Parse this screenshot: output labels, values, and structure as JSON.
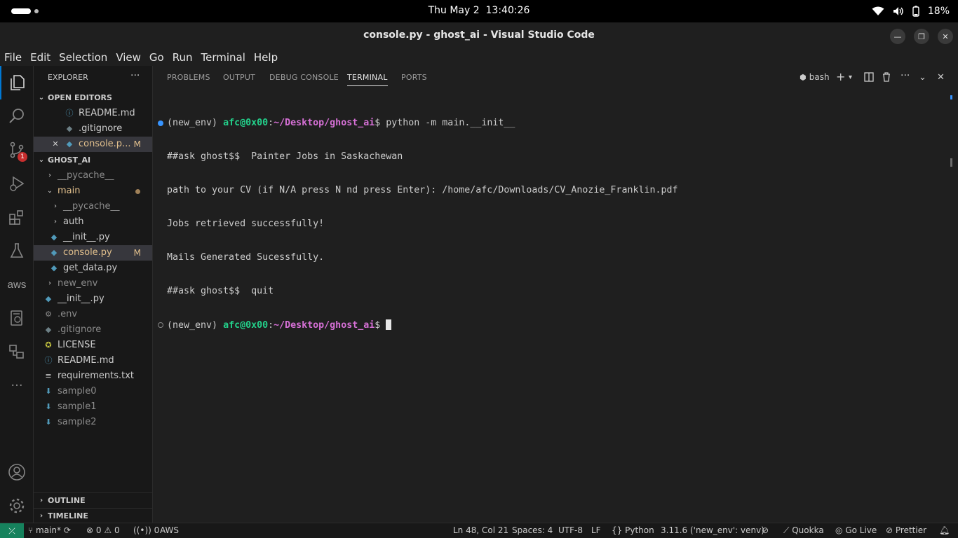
{
  "topbar": {
    "clock": "Thu May 2  13:40:26",
    "battery": "18%"
  },
  "window": {
    "title": "console.py - ghost_ai - Visual Studio Code"
  },
  "menu": [
    "File",
    "Edit",
    "Selection",
    "View",
    "Go",
    "Run",
    "Terminal",
    "Help"
  ],
  "activity": {
    "scm_badge": "1",
    "aws_label": "aws"
  },
  "sidebar": {
    "title": "EXPLORER",
    "open_editors_label": "OPEN EDITORS",
    "open_editors": [
      {
        "name": "README.md",
        "mod": ""
      },
      {
        "name": ".gitignore",
        "mod": ""
      },
      {
        "name": "console.p...",
        "mod": "M"
      }
    ],
    "project_label": "GHOST_AI",
    "tree": [
      {
        "name": "__pycache__",
        "mod": ""
      },
      {
        "name": "main",
        "mod": ""
      },
      {
        "name": "__pycache__",
        "mod": ""
      },
      {
        "name": "auth",
        "mod": ""
      },
      {
        "name": "__init__.py",
        "mod": ""
      },
      {
        "name": "console.py",
        "mod": "M"
      },
      {
        "name": "get_data.py",
        "mod": ""
      },
      {
        "name": "new_env",
        "mod": ""
      },
      {
        "name": "__init__.py",
        "mod": ""
      },
      {
        "name": ".env",
        "mod": ""
      },
      {
        "name": ".gitignore",
        "mod": ""
      },
      {
        "name": "LICENSE",
        "mod": ""
      },
      {
        "name": "README.md",
        "mod": ""
      },
      {
        "name": "requirements.txt",
        "mod": ""
      },
      {
        "name": "sample0",
        "mod": ""
      },
      {
        "name": "sample1",
        "mod": ""
      },
      {
        "name": "sample2",
        "mod": ""
      }
    ],
    "outline_label": "OUTLINE",
    "timeline_label": "TIMELINE"
  },
  "panel": {
    "tabs": [
      "PROBLEMS",
      "OUTPUT",
      "DEBUG CONSOLE",
      "TERMINAL",
      "PORTS"
    ],
    "active_tab": "TERMINAL",
    "shell": "bash"
  },
  "terminal": {
    "env": "(new_env) ",
    "user": "afc@0x00",
    "colon": ":",
    "path": "~/Desktop/ghost_ai",
    "dollar": "$ ",
    "command": "python -m main.__init__",
    "lines": [
      "##ask ghost$$  Painter Jobs in Saskachewan",
      "path to your CV (if N/A press N nd press Enter): /home/afc/Downloads/CV_Anozie_Franklin.pdf",
      "Jobs retrieved successfully!",
      "Mails Generated Sucessfully.",
      "##ask ghost$$  quit"
    ]
  },
  "status": {
    "branch": "main*",
    "errors": "0",
    "warnings": "0",
    "ports": "0",
    "aws": "AWS",
    "position": "Ln 48, Col 21",
    "spaces": "Spaces: 4",
    "encoding": "UTF-8",
    "eol": "LF",
    "language": "Python",
    "interpreter": "3.11.6 ('new_env': venv)",
    "quokka": "Quokka",
    "golive": "Go Live",
    "prettier": "Prettier"
  }
}
